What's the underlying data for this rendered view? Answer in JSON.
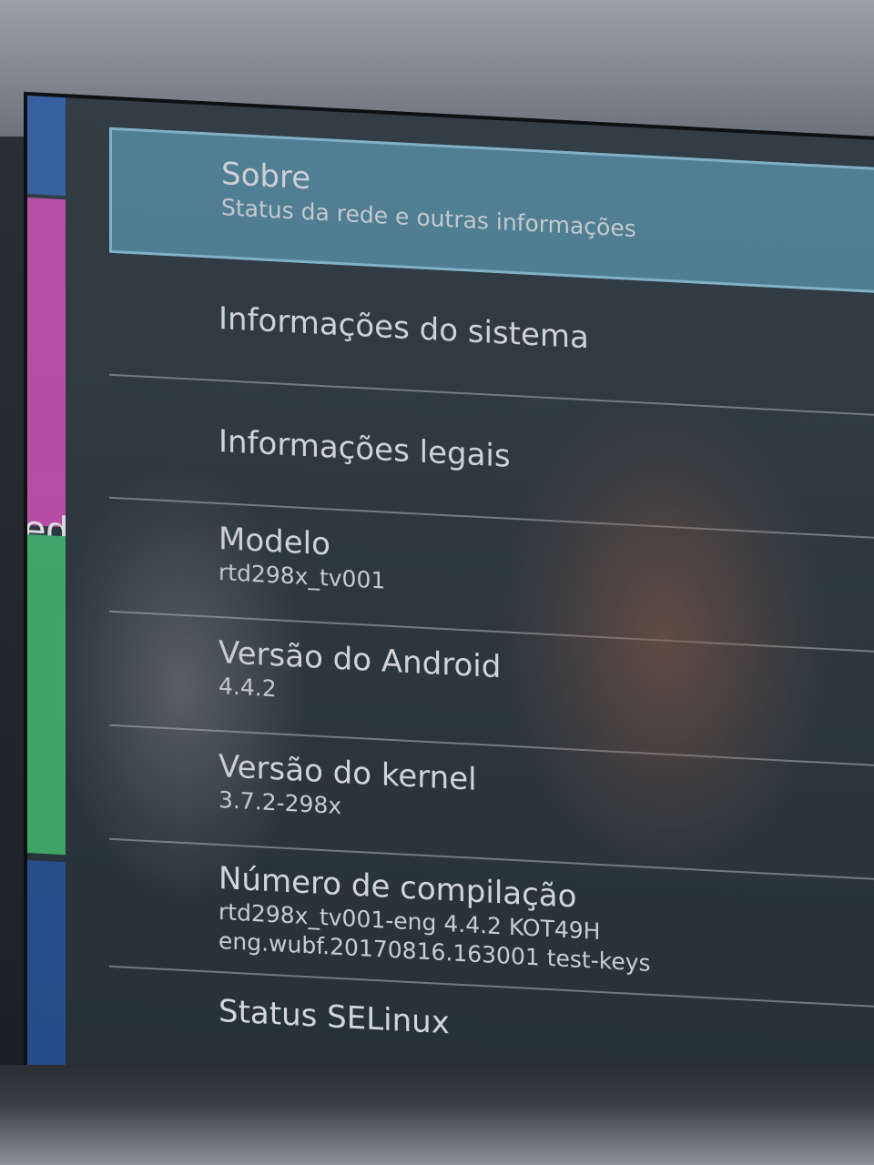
{
  "settings": {
    "items": [
      {
        "title": "Sobre",
        "subtitle": "Status da rede e outras informações",
        "selected": true
      },
      {
        "title": "Informações do sistema"
      },
      {
        "title": "Informações legais"
      },
      {
        "title": "Modelo",
        "subtitle": "rtd298x_tv001"
      },
      {
        "title": "Versão do Android",
        "subtitle": "4.4.2"
      },
      {
        "title": "Versão do kernel",
        "subtitle": "3.7.2-298x"
      },
      {
        "title": "Número de compilação",
        "subtitle": "rtd298x_tv001-eng 4.4.2 KOT49H",
        "subtitle2": "eng.wubf.20170816.163001 test-keys"
      },
      {
        "title": "Status SELinux"
      }
    ]
  },
  "launcher": {
    "tile_label": "ed",
    "colors": {
      "blue": "#2b5fb0",
      "magenta": "#d44bb8",
      "green": "#3fb96a",
      "darkblue": "#244f98"
    }
  },
  "colors": {
    "selected_background": "#58a0be",
    "text": "#f2f4f6"
  }
}
